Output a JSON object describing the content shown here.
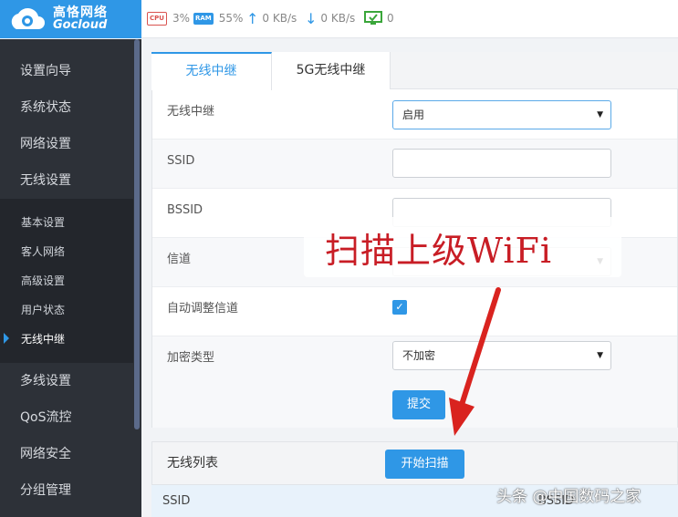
{
  "brand": {
    "name_cn": "高恪网络",
    "name_en": "Gocloud"
  },
  "status": {
    "cpu_label": "CPU",
    "cpu_value": "3%",
    "ram_label": "RAM",
    "ram_value": "55%",
    "upload": "0 KB/s",
    "download": "0 KB/s",
    "devices": "0"
  },
  "sidebar": {
    "items": [
      {
        "label": "设置向导"
      },
      {
        "label": "系统状态"
      },
      {
        "label": "网络设置"
      },
      {
        "label": "无线设置"
      },
      {
        "label": "多线设置"
      },
      {
        "label": "QoS流控"
      },
      {
        "label": "网络安全"
      },
      {
        "label": "分组管理"
      }
    ],
    "submenu": [
      {
        "label": "基本设置"
      },
      {
        "label": "客人网络"
      },
      {
        "label": "高级设置"
      },
      {
        "label": "用户状态"
      },
      {
        "label": "无线中继",
        "active": true
      }
    ]
  },
  "tabs": [
    {
      "label": "无线中继",
      "active": true
    },
    {
      "label": "5G无线中继"
    }
  ],
  "form": {
    "repeater_label": "无线中继",
    "repeater_value": "启用",
    "ssid_label": "SSID",
    "ssid_value": "",
    "bssid_label": "BSSID",
    "bssid_value": "",
    "channel_label": "信道",
    "channel_value": "",
    "auto_channel_label": "自动调整信道",
    "auto_channel_checked": true,
    "encryption_label": "加密类型",
    "encryption_value": "不加密",
    "submit_label": "提交"
  },
  "wifi_list": {
    "title": "无线列表",
    "scan_button": "开始扫描",
    "columns": [
      "SSID",
      "BSSID"
    ]
  },
  "overlay": {
    "text": "扫描上级WiFi"
  },
  "watermark": {
    "text": "头条 @中国数码之家"
  },
  "colors": {
    "accent": "#2f97e6",
    "sidebar": "#2d3138",
    "annotation": "#c81d25"
  }
}
